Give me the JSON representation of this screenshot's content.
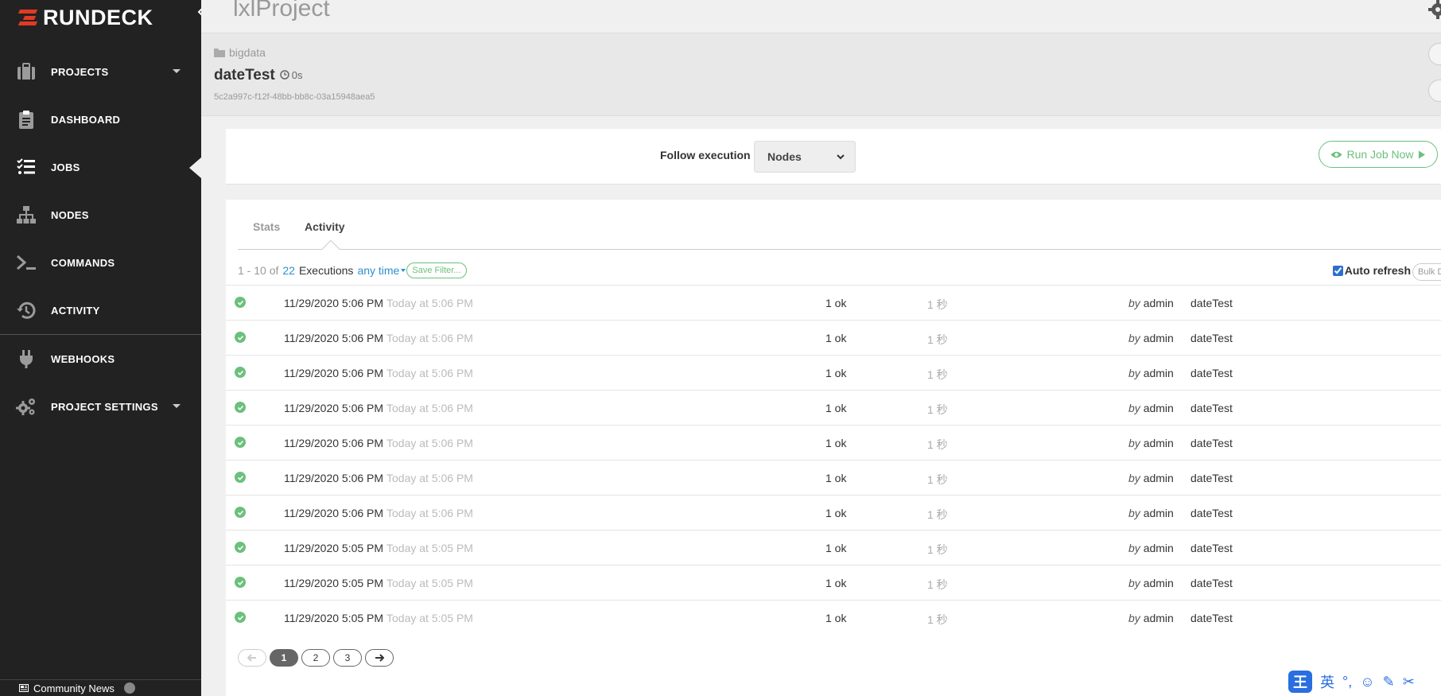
{
  "brand": {
    "name": "RUNDECK"
  },
  "sidebar": {
    "items": [
      {
        "label": "PROJECTS",
        "icon": "briefcase-icon",
        "caret": true
      },
      {
        "label": "DASHBOARD",
        "icon": "clipboard-icon",
        "caret": false
      },
      {
        "label": "JOBS",
        "icon": "list-check-icon",
        "caret": false,
        "active": true
      },
      {
        "label": "NODES",
        "icon": "sitemap-icon",
        "caret": false
      },
      {
        "label": "COMMANDS",
        "icon": "terminal-icon",
        "caret": false
      },
      {
        "label": "ACTIVITY",
        "icon": "history-icon",
        "caret": false
      },
      {
        "label": "WEBHOOKS",
        "icon": "plug-icon",
        "caret": false
      },
      {
        "label": "PROJECT SETTINGS",
        "icon": "cogs-icon",
        "caret": true
      }
    ],
    "community_news": "Community News"
  },
  "topbar": {
    "project_title": "lxlProject"
  },
  "job": {
    "group": "bigdata",
    "name": "dateTest",
    "duration": "0s",
    "uuid": "5c2a997c-f12f-48bb-bb8c-03a15948aea5"
  },
  "run": {
    "follow_label": "Follow execution",
    "follow_selected": "Nodes",
    "run_button": "Run Job Now"
  },
  "tabs": {
    "stats": "Stats",
    "activity": "Activity"
  },
  "summary": {
    "range": "1 - 10 of",
    "total": "22",
    "executions": "Executions",
    "any_time": "any time",
    "save_filter": "Save Filter...",
    "auto_refresh": "Auto refresh",
    "bulk": "Bulk Delete"
  },
  "executions": [
    {
      "date": "11/29/2020 5:06 PM",
      "relative": "Today at 5:06 PM",
      "result": "1 ok",
      "duration": "1 秒",
      "by": "by",
      "user": "admin",
      "job": "dateTest"
    },
    {
      "date": "11/29/2020 5:06 PM",
      "relative": "Today at 5:06 PM",
      "result": "1 ok",
      "duration": "1 秒",
      "by": "by",
      "user": "admin",
      "job": "dateTest"
    },
    {
      "date": "11/29/2020 5:06 PM",
      "relative": "Today at 5:06 PM",
      "result": "1 ok",
      "duration": "1 秒",
      "by": "by",
      "user": "admin",
      "job": "dateTest"
    },
    {
      "date": "11/29/2020 5:06 PM",
      "relative": "Today at 5:06 PM",
      "result": "1 ok",
      "duration": "1 秒",
      "by": "by",
      "user": "admin",
      "job": "dateTest"
    },
    {
      "date": "11/29/2020 5:06 PM",
      "relative": "Today at 5:06 PM",
      "result": "1 ok",
      "duration": "1 秒",
      "by": "by",
      "user": "admin",
      "job": "dateTest"
    },
    {
      "date": "11/29/2020 5:06 PM",
      "relative": "Today at 5:06 PM",
      "result": "1 ok",
      "duration": "1 秒",
      "by": "by",
      "user": "admin",
      "job": "dateTest"
    },
    {
      "date": "11/29/2020 5:06 PM",
      "relative": "Today at 5:06 PM",
      "result": "1 ok",
      "duration": "1 秒",
      "by": "by",
      "user": "admin",
      "job": "dateTest"
    },
    {
      "date": "11/29/2020 5:05 PM",
      "relative": "Today at 5:05 PM",
      "result": "1 ok",
      "duration": "1 秒",
      "by": "by",
      "user": "admin",
      "job": "dateTest"
    },
    {
      "date": "11/29/2020 5:05 PM",
      "relative": "Today at 5:05 PM",
      "result": "1 ok",
      "duration": "1 秒",
      "by": "by",
      "user": "admin",
      "job": "dateTest"
    },
    {
      "date": "11/29/2020 5:05 PM",
      "relative": "Today at 5:05 PM",
      "result": "1 ok",
      "duration": "1 秒",
      "by": "by",
      "user": "admin",
      "job": "dateTest"
    }
  ],
  "pager": {
    "pages": [
      "1",
      "2",
      "3"
    ],
    "current": "1"
  },
  "ime": {
    "logo": "王",
    "lang": "英"
  },
  "colors": {
    "success": "#6bc07c",
    "link": "#2d8fce",
    "brand_red": "#e43a23",
    "sidebar_bg": "#222223"
  }
}
